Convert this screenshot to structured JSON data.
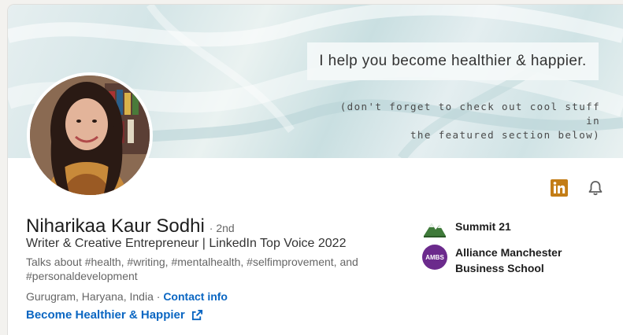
{
  "banner": {
    "tagline": "I help you become healthier & happier.",
    "note_line1": "(don't forget to check out cool stuff in",
    "note_line2": "the featured section below)"
  },
  "profile": {
    "name": "Niharikaa Kaur Sodhi",
    "degree": "· 2nd",
    "headline": "Writer & Creative Entrepreneur | LinkedIn Top Voice 2022",
    "talks_about": "Talks about #health, #writing, #mentalhealth, #selfimprovement, and #personaldevelopment",
    "location": "Gurugram, Haryana, India",
    "separator": " · ",
    "contact_label": "Contact info",
    "website_label": "Become Healthier & Happier"
  },
  "actions": {
    "linkedin_icon": "linkedin-icon",
    "bell_icon": "bell-icon"
  },
  "organizations": [
    {
      "name": "Summit 21",
      "logo": "mountain-logo"
    },
    {
      "name": "Alliance Manchester Business School",
      "logo_text": "AMBS",
      "logo": "ambs-logo"
    }
  ],
  "colors": {
    "link_blue": "#0a66c2",
    "linkedin_gold": "#c37d16",
    "ambs_purple": "#6b2a8c",
    "banner_teal": "#cfe2e4"
  }
}
